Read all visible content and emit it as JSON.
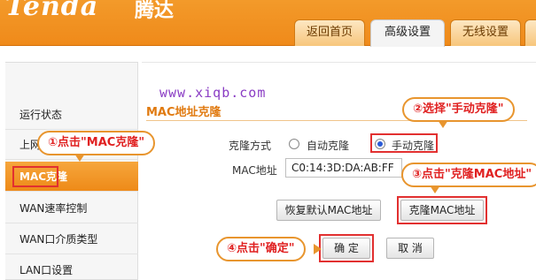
{
  "header": {
    "logo": "Tenda",
    "logo_cn": "腾达",
    "tabs": [
      {
        "label": "返回首页"
      },
      {
        "label": "高级设置"
      },
      {
        "label": "无线设置"
      }
    ]
  },
  "watermark": "www.xiqb.com",
  "sidebar": {
    "items": [
      {
        "label": "运行状态"
      },
      {
        "label": "上网设置"
      },
      {
        "label": "MAC克隆"
      },
      {
        "label": "WAN速率控制"
      },
      {
        "label": "WAN口介质类型"
      },
      {
        "label": "LAN口设置"
      }
    ]
  },
  "main": {
    "section_title": "MAC地址克隆",
    "clone_mode_label": "克隆方式",
    "option_auto": "自动克隆",
    "option_manual": "手动克隆",
    "selected_option": "手动克隆",
    "mac_label": "MAC地址",
    "mac_value": "C0:14:3D:DA:AB:FF",
    "restore_button": "恢复默认MAC地址",
    "clone_button": "克隆MAC地址",
    "ok_button": "确 定",
    "cancel_button": "取 消"
  },
  "callouts": {
    "step1": "①点击\"MAC克隆\"",
    "step2": "②选择\"手动克隆\"",
    "step3": "③点击\"克隆MAC地址\"",
    "step4": "④点击\"确定\""
  },
  "colors": {
    "accent": "#ef8a1a",
    "callout_text": "#e02020",
    "highlight": "#e23030",
    "watermark": "#8a3cc4"
  }
}
